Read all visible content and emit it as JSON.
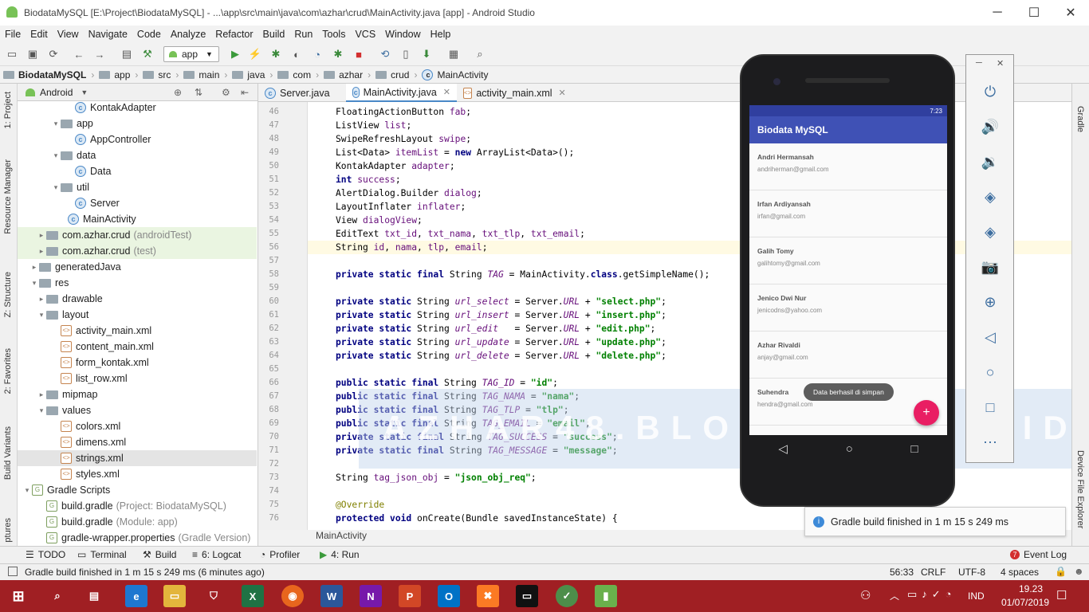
{
  "window": {
    "title": "BiodataMySQL [E:\\Project\\BiodataMySQL] - ...\\app\\src\\main\\java\\com\\azhar\\crud\\MainActivity.java [app] - Android Studio",
    "minimize": "─",
    "maximize": "☐",
    "close": "✕"
  },
  "menu": [
    "File",
    "Edit",
    "View",
    "Navigate",
    "Code",
    "Analyze",
    "Refactor",
    "Build",
    "Run",
    "Tools",
    "VCS",
    "Window",
    "Help"
  ],
  "toolbar": {
    "run_config": "app"
  },
  "breadcrumb": [
    "BiodataMySQL",
    "app",
    "src",
    "main",
    "java",
    "com",
    "azhar",
    "crud",
    "MainActivity"
  ],
  "left_tabs": [
    "1: Project",
    "Resource Manager",
    "Z: Structure",
    "2: Favorites",
    "Build Variants",
    "ptures"
  ],
  "project_panel": {
    "view": "Android",
    "tree": [
      {
        "label": "KontakAdapter",
        "note": "",
        "icon": "class",
        "indent": 6,
        "arrow": ""
      },
      {
        "label": "app",
        "note": "",
        "icon": "folder",
        "indent": 4,
        "arrow": "▾"
      },
      {
        "label": "AppController",
        "note": "",
        "icon": "class",
        "indent": 6,
        "arrow": ""
      },
      {
        "label": "data",
        "note": "",
        "icon": "folder",
        "indent": 4,
        "arrow": "▾"
      },
      {
        "label": "Data",
        "note": "",
        "icon": "class",
        "indent": 6,
        "arrow": ""
      },
      {
        "label": "util",
        "note": "",
        "icon": "folder",
        "indent": 4,
        "arrow": "▾"
      },
      {
        "label": "Server",
        "note": "",
        "icon": "class",
        "indent": 6,
        "arrow": ""
      },
      {
        "label": "MainActivity",
        "note": "",
        "icon": "class",
        "indent": 5,
        "arrow": ""
      },
      {
        "label": "com.azhar.crud",
        "note": "(androidTest)",
        "icon": "folder",
        "indent": 2,
        "arrow": "▸"
      },
      {
        "label": "com.azhar.crud",
        "note": "(test)",
        "icon": "folder",
        "indent": 2,
        "arrow": "▸"
      },
      {
        "label": "generatedJava",
        "note": "",
        "icon": "folder",
        "indent": 1,
        "arrow": "▸"
      },
      {
        "label": "res",
        "note": "",
        "icon": "folder",
        "indent": 1,
        "arrow": "▾"
      },
      {
        "label": "drawable",
        "note": "",
        "icon": "folder",
        "indent": 2,
        "arrow": "▸"
      },
      {
        "label": "layout",
        "note": "",
        "icon": "folder",
        "indent": 2,
        "arrow": "▾"
      },
      {
        "label": "activity_main.xml",
        "note": "",
        "icon": "xml",
        "indent": 4,
        "arrow": ""
      },
      {
        "label": "content_main.xml",
        "note": "",
        "icon": "xml",
        "indent": 4,
        "arrow": ""
      },
      {
        "label": "form_kontak.xml",
        "note": "",
        "icon": "xml",
        "indent": 4,
        "arrow": ""
      },
      {
        "label": "list_row.xml",
        "note": "",
        "icon": "xml",
        "indent": 4,
        "arrow": ""
      },
      {
        "label": "mipmap",
        "note": "",
        "icon": "folder",
        "indent": 2,
        "arrow": "▸"
      },
      {
        "label": "values",
        "note": "",
        "icon": "folder",
        "indent": 2,
        "arrow": "▾"
      },
      {
        "label": "colors.xml",
        "note": "",
        "icon": "xml",
        "indent": 4,
        "arrow": ""
      },
      {
        "label": "dimens.xml",
        "note": "",
        "icon": "xml",
        "indent": 4,
        "arrow": ""
      },
      {
        "label": "strings.xml",
        "note": "",
        "icon": "xml",
        "indent": 4,
        "arrow": ""
      },
      {
        "label": "styles.xml",
        "note": "",
        "icon": "xml",
        "indent": 4,
        "arrow": ""
      },
      {
        "label": "Gradle Scripts",
        "note": "",
        "icon": "gradle",
        "indent": 0,
        "arrow": "▾"
      },
      {
        "label": "build.gradle",
        "note": "(Project: BiodataMySQL)",
        "icon": "gradle",
        "indent": 2,
        "arrow": ""
      },
      {
        "label": "build.gradle",
        "note": "(Module: app)",
        "icon": "gradle",
        "indent": 2,
        "arrow": ""
      },
      {
        "label": "gradle-wrapper.properties",
        "note": "(Gradle Version)",
        "icon": "gradle",
        "indent": 2,
        "arrow": ""
      }
    ]
  },
  "editor_tabs": [
    "Server.java",
    "MainActivity.java",
    "activity_main.xml"
  ],
  "editor_footer": "MainActivity",
  "code_lines": [
    {
      "n": "46",
      "html": "FloatingActionButton <span class=\"fd\">fab</span>;"
    },
    {
      "n": "47",
      "html": "ListView <span class=\"fd\">list</span>;"
    },
    {
      "n": "48",
      "html": "SwipeRefreshLayout <span class=\"fd\">swipe</span>;"
    },
    {
      "n": "49",
      "html": "List&lt;Data&gt; <span class=\"fd\">itemList</span> = <span class=\"kw\">new</span> ArrayList&lt;Data&gt;();"
    },
    {
      "n": "50",
      "html": "KontakAdapter <span class=\"fd\">adapter</span>;"
    },
    {
      "n": "51",
      "html": "<span class=\"kw\">int</span> <span class=\"fd\">success</span>;"
    },
    {
      "n": "52",
      "html": "AlertDialog.Builder <span class=\"fd\">dialog</span>;"
    },
    {
      "n": "53",
      "html": "LayoutInflater <span class=\"fd\">inflater</span>;"
    },
    {
      "n": "54",
      "html": "View <span class=\"fd\">dialogView</span>;"
    },
    {
      "n": "55",
      "html": "EditText <span class=\"fd\">txt_id</span>, <span class=\"fd\">txt_nama</span>, <span class=\"fd\">txt_tlp</span>, <span class=\"fd\">txt_email</span>;"
    },
    {
      "n": "56",
      "html": "String <span class=\"fd\">id</span>, <span class=\"fd\">nama</span>, <span class=\"fd\">tlp</span>, <span class=\"fd\">email</span>;"
    },
    {
      "n": "57",
      "html": ""
    },
    {
      "n": "58",
      "html": "<span class=\"kw\">private static final</span> String <span class=\"it\">TAG</span> = MainActivity.<span class=\"kw\">class</span>.getSimpleName();"
    },
    {
      "n": "59",
      "html": ""
    },
    {
      "n": "60",
      "html": "<span class=\"kw\">private static</span> String <span class=\"it\">url_select</span> = Server.<span class=\"it\">URL</span> + <span class=\"st\">\"select.php\"</span>;"
    },
    {
      "n": "61",
      "html": "<span class=\"kw\">private static</span> String <span class=\"it\">url_insert</span> = Server.<span class=\"it\">URL</span> + <span class=\"st\">\"insert.php\"</span>;"
    },
    {
      "n": "62",
      "html": "<span class=\"kw\">private static</span> String <span class=\"it\">url_edit</span>   = Server.<span class=\"it\">URL</span> + <span class=\"st\">\"edit.php\"</span>;"
    },
    {
      "n": "63",
      "html": "<span class=\"kw\">private static</span> String <span class=\"it\">url_update</span> = Server.<span class=\"it\">URL</span> + <span class=\"st\">\"update.php\"</span>;"
    },
    {
      "n": "64",
      "html": "<span class=\"kw\">private static</span> String <span class=\"it\">url_delete</span> = Server.<span class=\"it\">URL</span> + <span class=\"st\">\"delete.php\"</span>;"
    },
    {
      "n": "65",
      "html": ""
    },
    {
      "n": "66",
      "html": "<span class=\"kw\">public static final</span> String <span class=\"it\">TAG_ID</span> = <span class=\"st\">\"id\"</span>;"
    },
    {
      "n": "67",
      "html": "<span class=\"kw\">public static final</span> String <span class=\"it\">TAG_NAMA</span> = <span class=\"st\">\"nama\"</span>;"
    },
    {
      "n": "68",
      "html": "<span class=\"kw\">public static final</span> String <span class=\"it\">TAG_TLP</span> = <span class=\"st\">\"tlp\"</span>;"
    },
    {
      "n": "69",
      "html": "<span class=\"kw\">public static final</span> String <span class=\"it\">TAG_EMAIL</span> = <span class=\"st\">\"email\"</span>;"
    },
    {
      "n": "70",
      "html": "<span class=\"kw\">private static final</span> String <span class=\"it\">TAG_SUCCESS</span> = <span class=\"st\">\"success\"</span>;"
    },
    {
      "n": "71",
      "html": "<span class=\"kw\">private static final</span> String <span class=\"it\">TAG_MESSAGE</span> = <span class=\"st\">\"message\"</span>;"
    },
    {
      "n": "72",
      "html": ""
    },
    {
      "n": "73",
      "html": "String <span class=\"fd\">tag_json_obj</span> = <span class=\"st\">\"json_obj_req\"</span>;"
    },
    {
      "n": "74",
      "html": ""
    },
    {
      "n": "75",
      "html": "<span class=\"an\">@Override</span>"
    },
    {
      "n": "76",
      "html": "<span class=\"kw\">protected void</span> onCreate(Bundle savedInstanceState) {"
    }
  ],
  "emulator": {
    "status_time": "7:23",
    "app_title": "Biodata MySQL",
    "contacts": [
      {
        "name": "Andri Hermansah",
        "email": "andriherman@gmail.com"
      },
      {
        "name": "Irfan Ardiyansah",
        "email": "irfan@gmail.com"
      },
      {
        "name": "Galih Tomy",
        "email": "galihtomy@gmail.com"
      },
      {
        "name": "Jenico Dwi Nur",
        "email": "jenicodns@yahoo.com"
      },
      {
        "name": "Azhar Rivaldi",
        "email": "anjay@gmail.com"
      },
      {
        "name": "Suhendra",
        "email": "hendra@gmail.com"
      }
    ],
    "toast": "Data berhasil di simpan",
    "fab": "+"
  },
  "watermark": "AZHAR48.BLOGSPOT.CO.ID",
  "right_tabs": [
    "Gradle",
    "Device File Explorer"
  ],
  "notification": "Gradle build finished in 1 m 15 s 249 ms",
  "bottom_tabs": [
    "TODO",
    "Terminal",
    "Build",
    "6: Logcat",
    "Profiler",
    "4: Run",
    "Event Log"
  ],
  "status": {
    "message": "Gradle build finished in 1 m 15 s 249 ms (6 minutes ago)",
    "position": "56:33",
    "line_sep": "CRLF",
    "encoding": "UTF-8",
    "indent": "4 spaces"
  },
  "taskbar": {
    "lang": "IND",
    "time": "19.23",
    "date": "01/07/2019"
  }
}
